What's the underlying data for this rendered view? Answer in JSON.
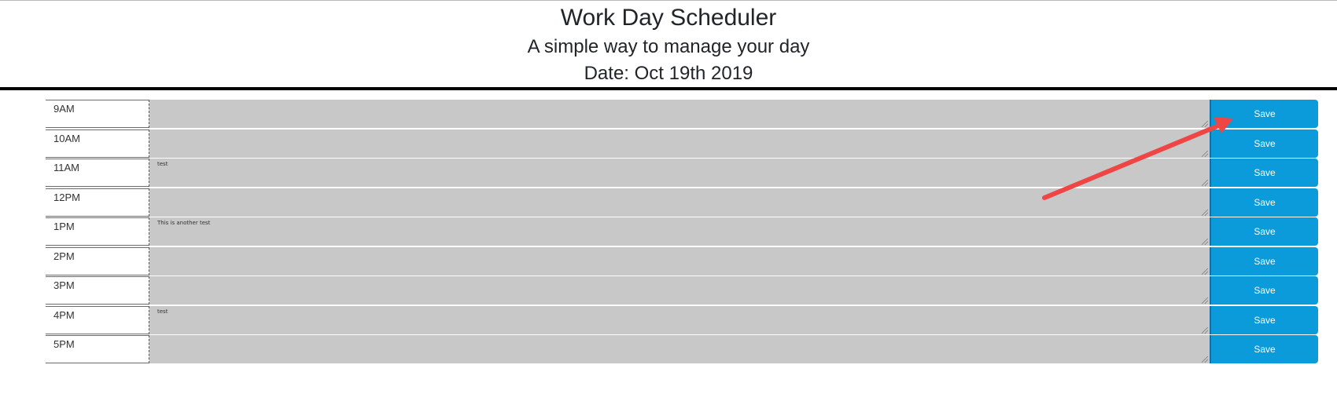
{
  "header": {
    "title": "Work Day Scheduler",
    "subtitle": "A simple way to manage your day",
    "date": "Date: Oct 19th 2019"
  },
  "save_label": "Save",
  "rows": [
    {
      "hour": "9AM",
      "text": ""
    },
    {
      "hour": "10AM",
      "text": ""
    },
    {
      "hour": "11AM",
      "text": "test"
    },
    {
      "hour": "12PM",
      "text": ""
    },
    {
      "hour": "1PM",
      "text": "This is another test"
    },
    {
      "hour": "2PM",
      "text": ""
    },
    {
      "hour": "3PM",
      "text": ""
    },
    {
      "hour": "4PM",
      "text": "test"
    },
    {
      "hour": "5PM",
      "text": ""
    }
  ],
  "colors": {
    "save_button": "#0b9ada",
    "textarea_bg": "#c8c8c8",
    "annotation_arrow": "#f04545"
  }
}
